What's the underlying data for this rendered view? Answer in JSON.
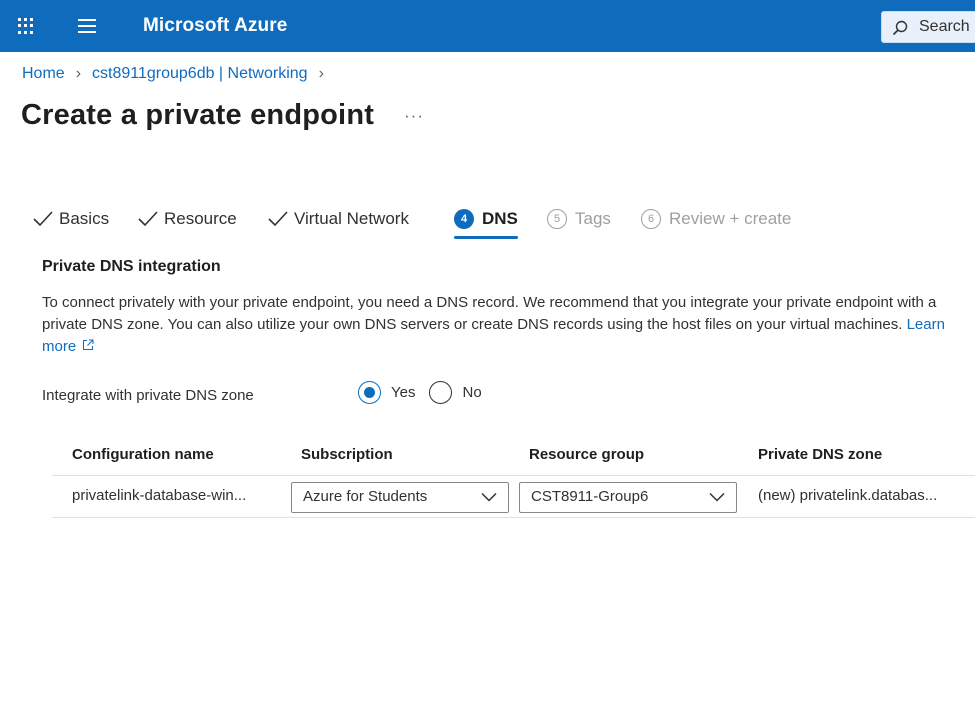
{
  "header": {
    "brand": "Microsoft Azure",
    "search_placeholder": "Search r",
    "menu_icon": "waffle-icon",
    "nav_icon": "hamburger-icon"
  },
  "breadcrumb": {
    "home": "Home",
    "parent": "cst8911group6db | Networking"
  },
  "page": {
    "title": "Create a private endpoint",
    "more": "···"
  },
  "tabs": [
    {
      "label": "Basics",
      "state": "completed"
    },
    {
      "label": "Resource",
      "state": "completed"
    },
    {
      "label": "Virtual Network",
      "state": "completed"
    },
    {
      "number": "4",
      "label": "DNS",
      "state": "active"
    },
    {
      "number": "5",
      "label": "Tags",
      "state": "disabled"
    },
    {
      "number": "6",
      "label": "Review + create",
      "state": "disabled"
    }
  ],
  "dns": {
    "section_title": "Private DNS integration",
    "description": "To connect privately with your private endpoint, you need a DNS record. We recommend that you integrate your private endpoint with a private DNS zone. You can also utilize your own DNS servers or create DNS records using the host files on your virtual machines.",
    "learn_more": "Learn more",
    "integrate_label": "Integrate with private DNS zone",
    "options": {
      "yes": "Yes",
      "no": "No"
    },
    "selected": "Yes"
  },
  "table": {
    "headers": [
      "Configuration name",
      "Subscription",
      "Resource group",
      "Private DNS zone"
    ],
    "row": {
      "config_name": "privatelink-database-win...",
      "subscription": "Azure for Students",
      "resource_group": "CST8911-Group6",
      "dns_zone": "(new) privatelink.databas..."
    }
  },
  "colors": {
    "accent": "#0f6cbd",
    "text": "#323130",
    "disabled": "#a19f9d"
  }
}
